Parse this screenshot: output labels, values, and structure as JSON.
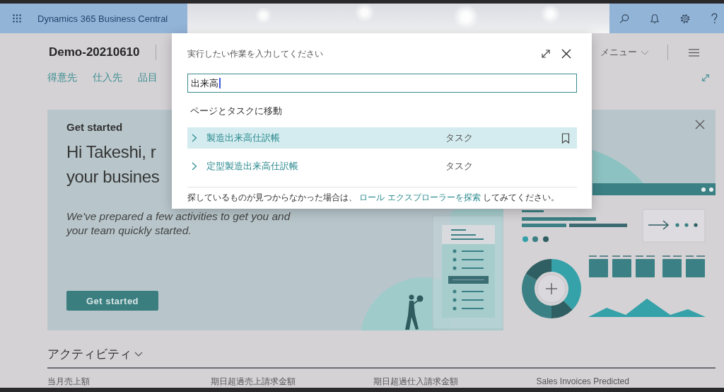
{
  "app_bar": {
    "title": "Dynamics 365 Business Central"
  },
  "page": {
    "company": "Demo-20210610",
    "nav": [
      {
        "label": "得意先"
      },
      {
        "label": "仕入先"
      },
      {
        "label": "品目"
      }
    ],
    "menu": "メニュー"
  },
  "get_started": {
    "eyebrow": "Get started",
    "heading": [
      "Hi Takeshi, r",
      "your busines"
    ],
    "body": "We've prepared a few activities to get you and your team quickly started.",
    "button": "Get started"
  },
  "activities": {
    "title": "アクティビティ",
    "tiles": [
      {
        "label": "当月売上額"
      },
      {
        "label": "期日超過売上請求金額"
      },
      {
        "label": "期日超過仕入請求金額"
      },
      {
        "label": "Sales Invoices Predicted"
      }
    ]
  },
  "dialog": {
    "title": "実行したい作業を入力してください",
    "search": {
      "value": "出来高",
      "focused": true
    },
    "section": "ページとタスクに移動",
    "results": [
      {
        "name": "製造出来高仕訳帳",
        "type": "タスク",
        "selected": true
      },
      {
        "name": "定型製造出来高仕訳帳",
        "type": "タスク",
        "selected": false
      }
    ],
    "footer": {
      "before": "探しているものが見つからなかった場合は、",
      "link": "ロール エクスプローラーを探索",
      "after": "してみてください。"
    }
  }
}
